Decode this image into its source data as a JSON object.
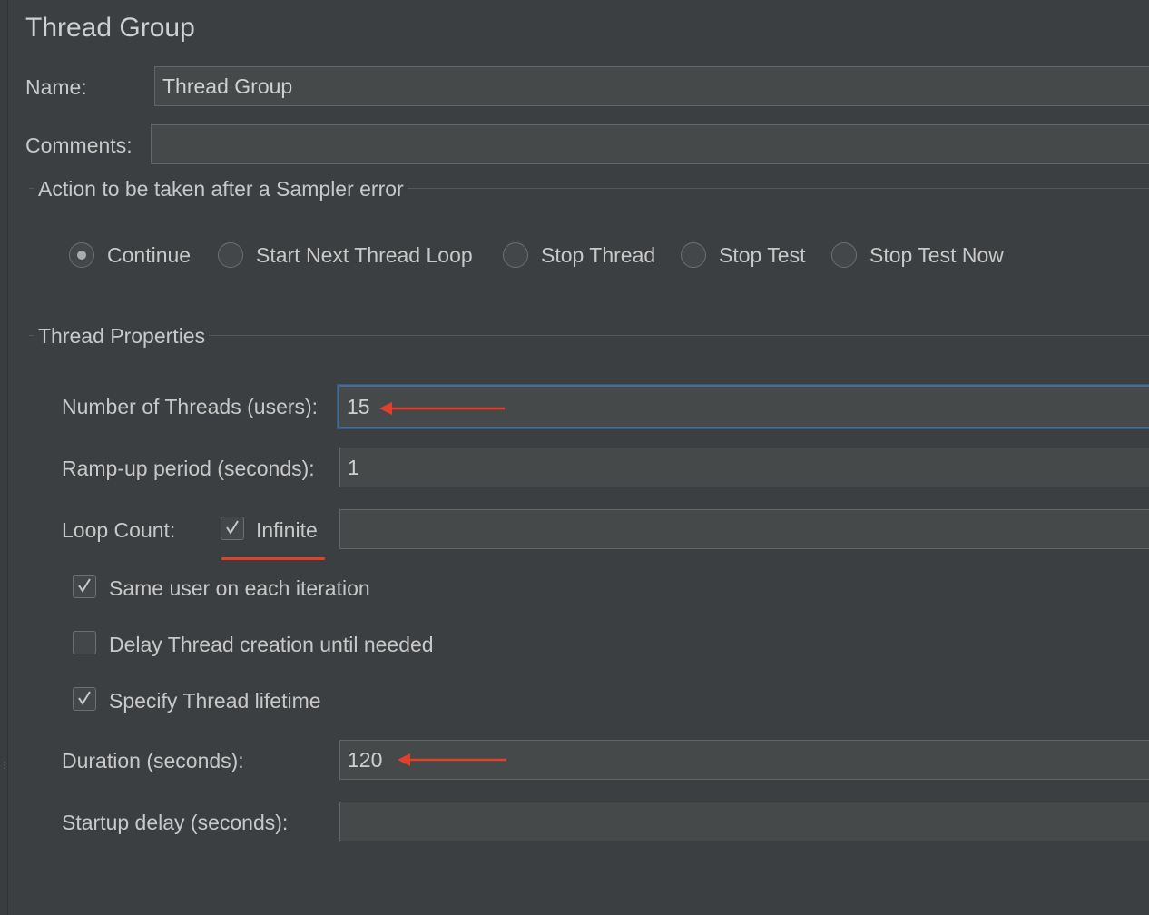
{
  "panel": {
    "title": "Thread Group"
  },
  "name": {
    "label": "Name:",
    "value": "Thread Group"
  },
  "comments": {
    "label": "Comments:",
    "value": ""
  },
  "sampler_error": {
    "title": "Action to be taken after a Sampler error",
    "options": [
      "Continue",
      "Start Next Thread Loop",
      "Stop Thread",
      "Stop Test",
      "Stop Test Now"
    ],
    "selected": "Continue"
  },
  "thread_properties": {
    "title": "Thread Properties",
    "num_threads": {
      "label": "Number of Threads (users):",
      "value": "15"
    },
    "ramp_up": {
      "label": "Ramp-up period (seconds):",
      "value": "1"
    },
    "loop_count": {
      "label": "Loop Count:",
      "infinite_label": "Infinite",
      "infinite_checked": true,
      "value": ""
    },
    "same_user": {
      "label": "Same user on each iteration",
      "checked": true
    },
    "delay_creation": {
      "label": "Delay Thread creation until needed",
      "checked": false
    },
    "specify_lifetime": {
      "label": "Specify Thread lifetime",
      "checked": true
    },
    "duration": {
      "label": "Duration (seconds):",
      "value": "120"
    },
    "startup_delay": {
      "label": "Startup delay (seconds):",
      "value": ""
    }
  },
  "annotation_color": "#e2402a"
}
